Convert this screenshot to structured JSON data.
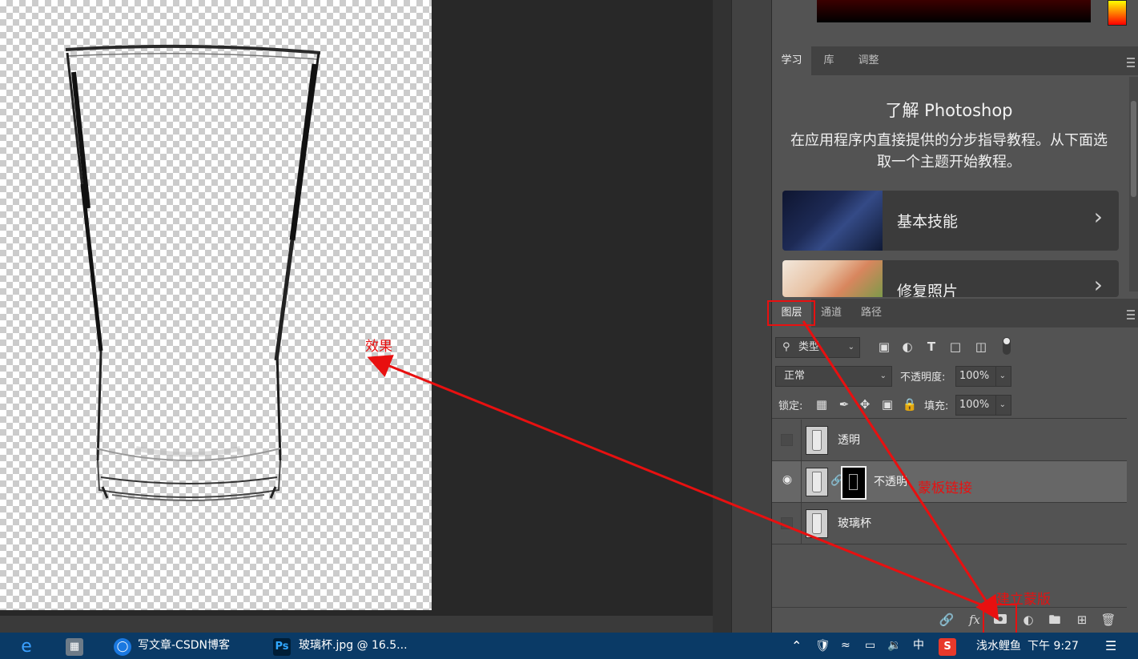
{
  "learn_panel": {
    "tabs": [
      "学习",
      "库",
      "调整"
    ],
    "title": "了解 Photoshop",
    "description": "在应用程序内直接提供的分步指导教程。从下面选取一个主题开始教程。",
    "cards": [
      {
        "label": "基本技能",
        "chevron": "›"
      },
      {
        "label": "修复照片",
        "chevron": "›"
      }
    ]
  },
  "layers_panel": {
    "tabs": [
      "图层",
      "通道",
      "路径"
    ],
    "filter_kind": "类型",
    "blend_mode": "正常",
    "opacity_label": "不透明度:",
    "opacity_value": "100%",
    "lock_label": "锁定:",
    "fill_label": "填充:",
    "fill_value": "100%",
    "layers": [
      {
        "name": "透明",
        "visible": false,
        "has_mask": false,
        "selected": false
      },
      {
        "name": "不透明",
        "visible": true,
        "has_mask": true,
        "selected": true
      },
      {
        "name": "玻璃杯",
        "visible": false,
        "has_mask": false,
        "selected": false
      }
    ],
    "footer_icons": [
      "link-icon",
      "fx-icon",
      "add-mask-icon",
      "adjustment-icon",
      "folder-icon",
      "new-layer-icon",
      "trash-icon"
    ],
    "fx_label": "fx"
  },
  "annotations": {
    "effect_label": "效果",
    "mask_link_label": "蒙板链接",
    "create_mask_label": "建立蒙版",
    "color": "#e81010"
  },
  "taskbar": {
    "items": [
      {
        "label": "写文章-CSDN博客"
      },
      {
        "label": "玻璃杯.jpg @ 16.5..."
      }
    ],
    "user": "浅水鲤鱼",
    "time": "下午 9:27",
    "ime_label": "中"
  },
  "colors": {
    "panel_bg": "#535353",
    "tab_bar": "#424242",
    "selected_layer": "#676767",
    "taskbar": "#0a3a66"
  }
}
